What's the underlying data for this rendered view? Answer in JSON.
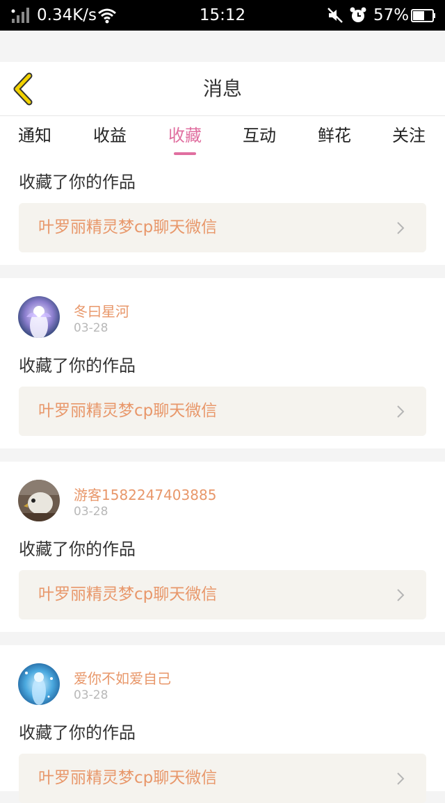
{
  "status_bar": {
    "speed": "0.34K/s",
    "time": "15:12",
    "battery": "57%"
  },
  "header": {
    "title": "消息",
    "back_icon": "chevron-left-icon",
    "accent": "#f2d200"
  },
  "tabs": [
    {
      "label": "通知"
    },
    {
      "label": "收益"
    },
    {
      "label": "收藏",
      "active": true
    },
    {
      "label": "互动"
    },
    {
      "label": "鲜花"
    },
    {
      "label": "关注"
    }
  ],
  "colors": {
    "tab_active": "#e06fa0",
    "username": "#e8976a",
    "link_bg": "#f5f3ee"
  },
  "notifications": [
    {
      "action": "收藏了你的作品",
      "work": "叶罗丽精灵梦cp聊天微信"
    },
    {
      "user": "冬曰星河",
      "date": "03-28",
      "action": "收藏了你的作品",
      "work": "叶罗丽精灵梦cp聊天微信"
    },
    {
      "user": "游客1582247403885",
      "date": "03-28",
      "action": "收藏了你的作品",
      "work": "叶罗丽精灵梦cp聊天微信"
    },
    {
      "user": "爱你不如爱自己",
      "date": "03-28",
      "action": "收藏了你的作品",
      "work": "叶罗丽精灵梦cp聊天微信"
    }
  ]
}
